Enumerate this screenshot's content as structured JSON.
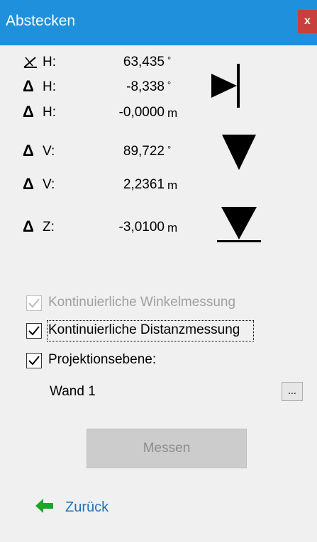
{
  "window": {
    "title": "Abstecken",
    "close_label": "x"
  },
  "readings": [
    {
      "symbol": "angle-symbol",
      "label": "H:",
      "value": "63,435",
      "unit": "°"
    },
    {
      "symbol": "Δ",
      "label": "H:",
      "value": "-8,338",
      "unit": "°"
    },
    {
      "symbol": "Δ",
      "label": "H:",
      "value": "-0,0000",
      "unit": "m"
    },
    {
      "symbol": "Δ",
      "label": "V:",
      "value": "89,722",
      "unit": "°"
    },
    {
      "symbol": "Δ",
      "label": "V:",
      "value": "2,2361",
      "unit": "m"
    },
    {
      "symbol": "Δ",
      "label": "Z:",
      "value": "-3,0100",
      "unit": "m"
    }
  ],
  "indicators": {
    "horizontal": "arrow-right-to-bar-icon",
    "vertical": "triangle-down-icon",
    "height": "triangle-down-to-bar-icon"
  },
  "options": {
    "continuous_angle": {
      "label": "Kontinuierliche Winkelmessung",
      "checked": true,
      "enabled": false
    },
    "continuous_distance": {
      "label": "Kontinuierliche Distanzmessung",
      "checked": true,
      "enabled": true
    },
    "projection_plane": {
      "label": "Projektionsebene:",
      "checked": true,
      "enabled": true
    }
  },
  "projection_plane_value": "Wand 1",
  "browse_label": "...",
  "measure_label": "Messen",
  "back": {
    "label": "Zurück",
    "icon": "arrow-left-icon",
    "icon_color": "#1aa626"
  },
  "colors": {
    "titlebar": "#1e90dc",
    "close": "#c8403c",
    "link": "#1e72b8"
  }
}
